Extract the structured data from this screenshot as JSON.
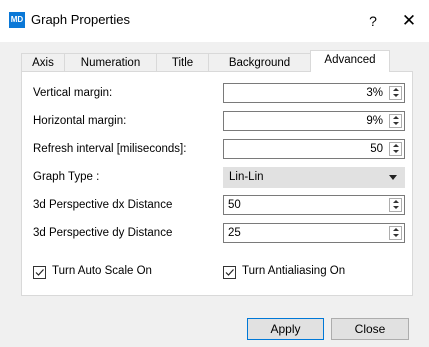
{
  "window": {
    "icon_text": "MD",
    "title": "Graph Properties",
    "help_glyph": "?",
    "close_glyph": "✕"
  },
  "tabs": [
    {
      "label": "Axis"
    },
    {
      "label": "Numeration"
    },
    {
      "label": "Title"
    },
    {
      "label": "Background"
    },
    {
      "label": "Advanced",
      "active": true
    }
  ],
  "advanced": {
    "vertical_margin": {
      "label": "Vertical margin:",
      "value": "3%"
    },
    "horizontal_margin": {
      "label": "Horizontal margin:",
      "value": "9%"
    },
    "refresh_interval": {
      "label": "Refresh interval [miliseconds]:",
      "value": "50"
    },
    "graph_type": {
      "label": "Graph Type :",
      "value": "Lin-Lin"
    },
    "dx_distance": {
      "label": "3d Perspective dx Distance",
      "value": "50"
    },
    "dy_distance": {
      "label": "3d Perspective dy Distance",
      "value": "25"
    },
    "auto_scale": {
      "label": "Turn Auto Scale On",
      "checked": true
    },
    "antialiasing": {
      "label": "Turn Antialiasing On",
      "checked": true
    }
  },
  "buttons": {
    "apply": "Apply",
    "close": "Close"
  }
}
